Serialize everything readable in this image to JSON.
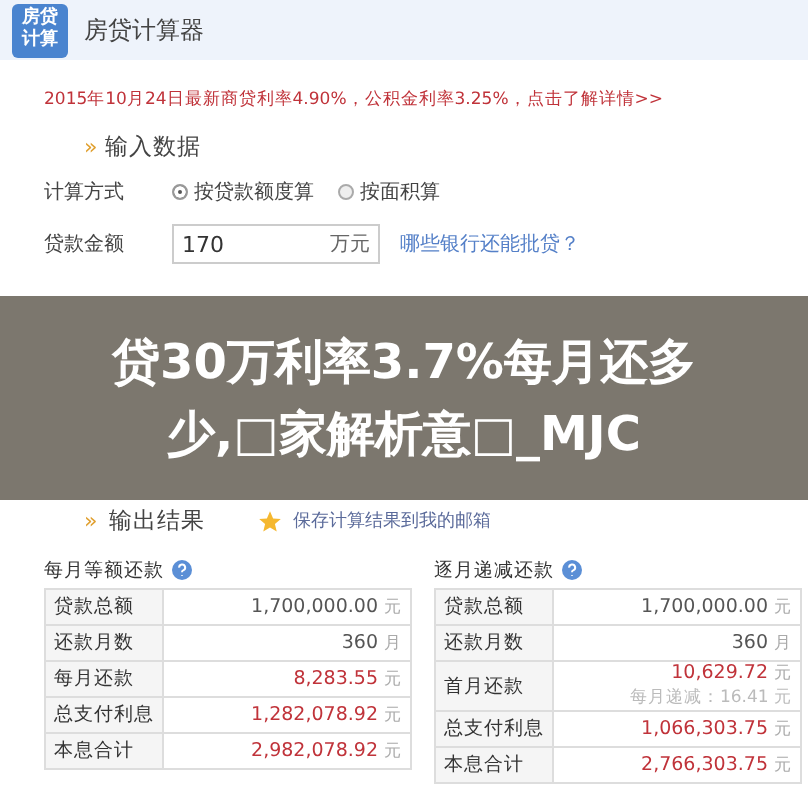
{
  "header": {
    "logo_lines": [
      "房贷",
      "计算"
    ],
    "title": "房贷计算器"
  },
  "notice": "2015年10月24日最新商贷利率4.90%，公积金利率3.25%，点击了解详情>>",
  "input_section": {
    "title": "输入数据",
    "marker": "»"
  },
  "form": {
    "method": {
      "label": "计算方式",
      "options": [
        {
          "label": "按贷款额度算",
          "selected": true
        },
        {
          "label": "按面积算",
          "selected": false
        }
      ]
    },
    "amount": {
      "label": "贷款金额",
      "value": "170",
      "unit": "万元",
      "link": "哪些银行还能批贷？"
    }
  },
  "overlay_title": "贷30万利率3.7%每月还多少,□家解析意□_MJC",
  "output_section": {
    "title": "输出结果",
    "marker": "»",
    "save_link": "保存计算结果到我的邮箱"
  },
  "tables": [
    {
      "title": "每月等额还款",
      "rows": [
        {
          "label": "贷款总额",
          "value": "1,700,000.00",
          "unit": "元",
          "highlight": false
        },
        {
          "label": "还款月数",
          "value": "360",
          "unit": "月",
          "highlight": false
        },
        {
          "label": "每月还款",
          "value": "8,283.55",
          "unit": "元",
          "highlight": true
        },
        {
          "label": "总支付利息",
          "value": "1,282,078.92",
          "unit": "元",
          "highlight": true
        },
        {
          "label": "本息合计",
          "value": "2,982,078.92",
          "unit": "元",
          "highlight": true
        }
      ]
    },
    {
      "title": "逐月递减还款",
      "rows": [
        {
          "label": "贷款总额",
          "value": "1,700,000.00",
          "unit": "元",
          "highlight": false
        },
        {
          "label": "还款月数",
          "value": "360",
          "unit": "月",
          "highlight": false
        },
        {
          "label": "首月还款",
          "value": "10,629.72",
          "unit": "元",
          "highlight": true,
          "note": "每月递减：16.41 元"
        },
        {
          "label": "总支付利息",
          "value": "1,066,303.75",
          "unit": "元",
          "highlight": true
        },
        {
          "label": "本息合计",
          "value": "2,766,303.75",
          "unit": "元",
          "highlight": true
        }
      ]
    }
  ]
}
